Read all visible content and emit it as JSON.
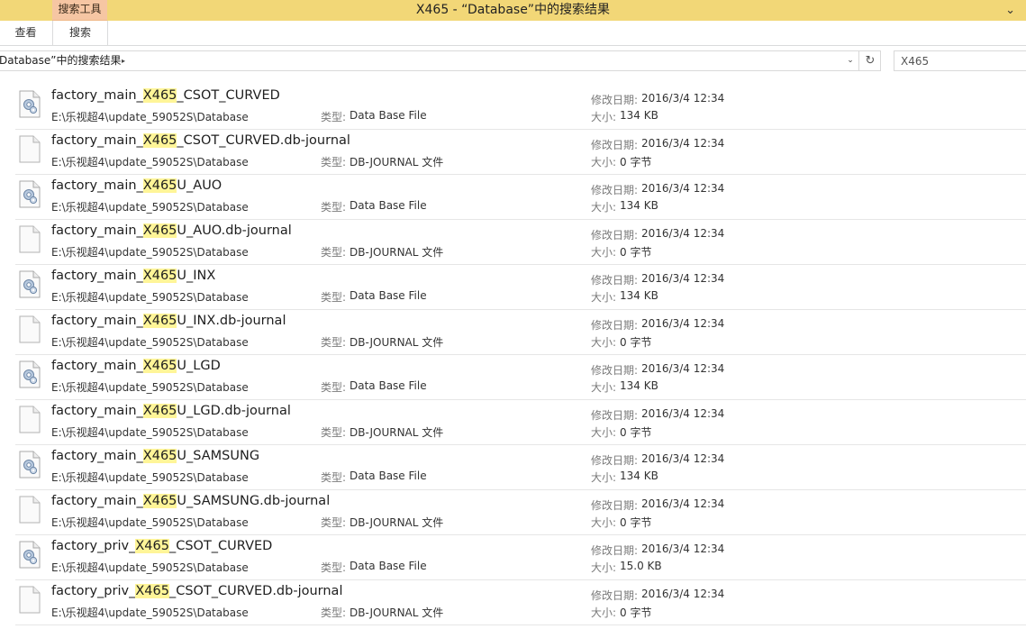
{
  "window": {
    "title": "X465 - “Database”中的搜索结果",
    "context_tab": "搜索工具",
    "chevron": "⌄"
  },
  "ribbon": {
    "tabs": [
      "查看",
      "搜索"
    ]
  },
  "address": {
    "breadcrumb": "Database”中的搜索结果",
    "separator": "▸",
    "dropdown": "⌄",
    "refresh": "↻"
  },
  "search": {
    "value": "X465",
    "placeholder": ""
  },
  "labels": {
    "type": "类型:",
    "modified": "修改日期:",
    "size": "大小:"
  },
  "colors": {
    "titlebar": "#f2d777",
    "context_tab": "#f6c6a3",
    "highlight": "#fff598"
  },
  "files": [
    {
      "pre": "factory_main_",
      "hit": "X465",
      "post": "_CSOT_CURVED",
      "path": "E:\\乐视超4\\update_59052S\\Database",
      "type": "Data Base File",
      "date": "2016/3/4 12:34",
      "size": "134 KB",
      "icon": "db-file-icon"
    },
    {
      "pre": "factory_main_",
      "hit": "X465",
      "post": "_CSOT_CURVED.db-journal",
      "path": "E:\\乐视超4\\update_59052S\\Database",
      "type": "DB-JOURNAL 文件",
      "date": "2016/3/4 12:34",
      "size": "0 字节",
      "icon": "blank-file-icon"
    },
    {
      "pre": "factory_main_",
      "hit": "X465",
      "post": "U_AUO",
      "path": "E:\\乐视超4\\update_59052S\\Database",
      "type": "Data Base File",
      "date": "2016/3/4 12:34",
      "size": "134 KB",
      "icon": "db-file-icon"
    },
    {
      "pre": "factory_main_",
      "hit": "X465",
      "post": "U_AUO.db-journal",
      "path": "E:\\乐视超4\\update_59052S\\Database",
      "type": "DB-JOURNAL 文件",
      "date": "2016/3/4 12:34",
      "size": "0 字节",
      "icon": "blank-file-icon"
    },
    {
      "pre": "factory_main_",
      "hit": "X465",
      "post": "U_INX",
      "path": "E:\\乐视超4\\update_59052S\\Database",
      "type": "Data Base File",
      "date": "2016/3/4 12:34",
      "size": "134 KB",
      "icon": "db-file-icon"
    },
    {
      "pre": "factory_main_",
      "hit": "X465",
      "post": "U_INX.db-journal",
      "path": "E:\\乐视超4\\update_59052S\\Database",
      "type": "DB-JOURNAL 文件",
      "date": "2016/3/4 12:34",
      "size": "0 字节",
      "icon": "blank-file-icon"
    },
    {
      "pre": "factory_main_",
      "hit": "X465",
      "post": "U_LGD",
      "path": "E:\\乐视超4\\update_59052S\\Database",
      "type": "Data Base File",
      "date": "2016/3/4 12:34",
      "size": "134 KB",
      "icon": "db-file-icon"
    },
    {
      "pre": "factory_main_",
      "hit": "X465",
      "post": "U_LGD.db-journal",
      "path": "E:\\乐视超4\\update_59052S\\Database",
      "type": "DB-JOURNAL 文件",
      "date": "2016/3/4 12:34",
      "size": "0 字节",
      "icon": "blank-file-icon"
    },
    {
      "pre": "factory_main_",
      "hit": "X465",
      "post": "U_SAMSUNG",
      "path": "E:\\乐视超4\\update_59052S\\Database",
      "type": "Data Base File",
      "date": "2016/3/4 12:34",
      "size": "134 KB",
      "icon": "db-file-icon"
    },
    {
      "pre": "factory_main_",
      "hit": "X465",
      "post": "U_SAMSUNG.db-journal",
      "path": "E:\\乐视超4\\update_59052S\\Database",
      "type": "DB-JOURNAL 文件",
      "date": "2016/3/4 12:34",
      "size": "0 字节",
      "icon": "blank-file-icon"
    },
    {
      "pre": "factory_priv_",
      "hit": "X465",
      "post": "_CSOT_CURVED",
      "path": "E:\\乐视超4\\update_59052S\\Database",
      "type": "Data Base File",
      "date": "2016/3/4 12:34",
      "size": "15.0 KB",
      "icon": "db-file-icon"
    },
    {
      "pre": "factory_priv_",
      "hit": "X465",
      "post": "_CSOT_CURVED.db-journal",
      "path": "E:\\乐视超4\\update_59052S\\Database",
      "type": "DB-JOURNAL 文件",
      "date": "2016/3/4 12:34",
      "size": "0 字节",
      "icon": "blank-file-icon"
    }
  ]
}
